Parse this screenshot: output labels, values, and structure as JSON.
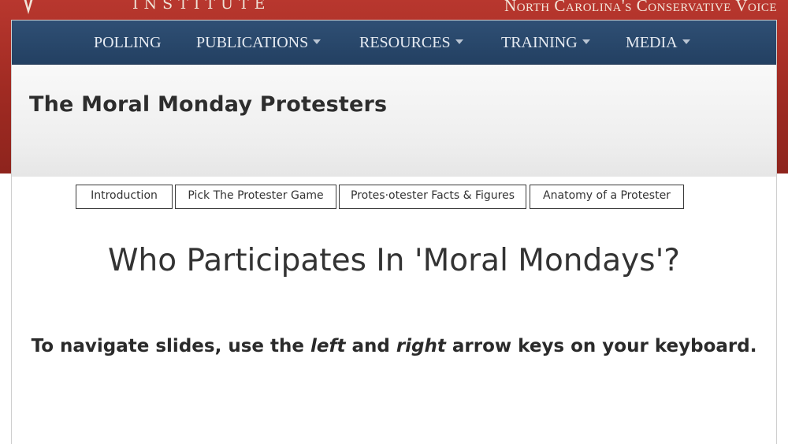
{
  "header": {
    "org_name": "INSTITUTE",
    "tagline": "North Carolina's Conservative Voice"
  },
  "nav": {
    "items": [
      {
        "label": "POLLING",
        "dropdown": false
      },
      {
        "label": "PUBLICATIONS",
        "dropdown": true
      },
      {
        "label": "RESOURCES",
        "dropdown": true
      },
      {
        "label": "TRAINING",
        "dropdown": true
      },
      {
        "label": "MEDIA",
        "dropdown": true
      }
    ]
  },
  "page": {
    "title": "The Moral Monday Protesters"
  },
  "tabs": [
    {
      "label": "Introduction"
    },
    {
      "label": "Pick The Protester Game"
    },
    {
      "label": "Protes·otester Facts & Figures"
    },
    {
      "label": "Anatomy of a Protester"
    }
  ],
  "slide": {
    "heading": "Who Participates In 'Moral Mondays'?",
    "instructions": {
      "part1": "To navigate slides, use the ",
      "left": "left",
      "part2": " and ",
      "right": "right",
      "part3": " arrow keys on your keyboard."
    }
  },
  "colors": {
    "header_red": "#a52d25",
    "nav_blue": "#2a4769",
    "nav_text": "#e6ebf2",
    "title_text": "#2d2d2d"
  }
}
